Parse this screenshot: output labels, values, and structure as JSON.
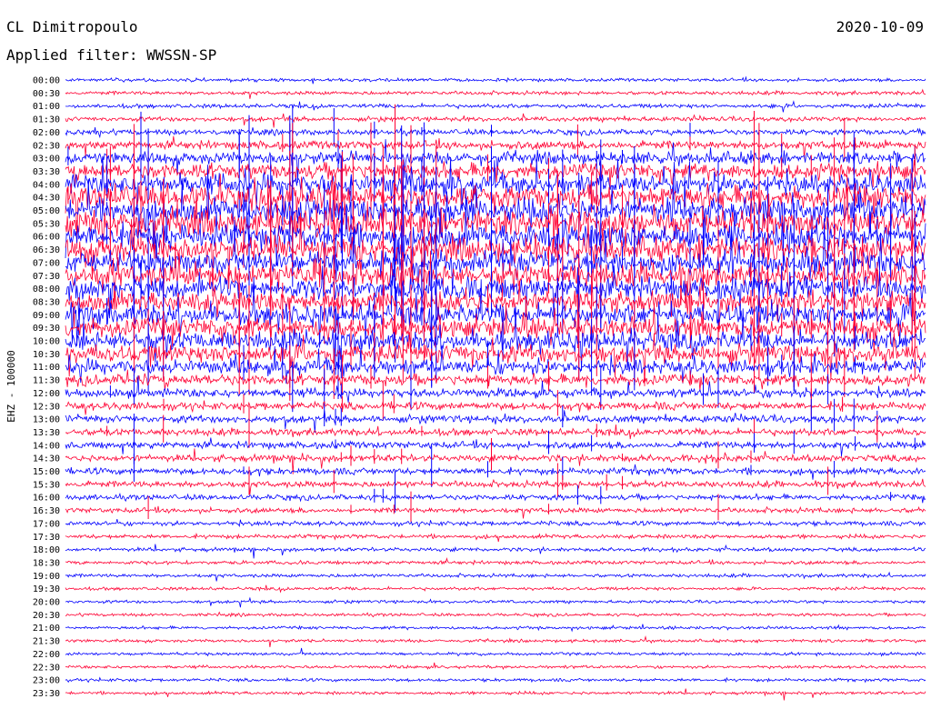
{
  "header": {
    "station": "CL Dimitropoulo",
    "filter_prefix": "Applied filter:",
    "filter_name": "WWSSN-SP",
    "date": "2020-10-09"
  },
  "chart_data": {
    "type": "line",
    "title": "CL Dimitropoulo",
    "subtitle": "Applied filter: WWSSN-SP",
    "date": "2020-10-09",
    "ylabel": "EHZ - 100000",
    "xlabel": "",
    "row_labels": [
      "00:00",
      "00:30",
      "01:00",
      "01:30",
      "02:00",
      "02:30",
      "03:00",
      "03:30",
      "04:00",
      "04:30",
      "05:00",
      "05:30",
      "06:00",
      "06:30",
      "07:00",
      "07:30",
      "08:00",
      "08:30",
      "09:00",
      "09:30",
      "10:00",
      "10:30",
      "11:00",
      "11:30",
      "12:00",
      "12:30",
      "13:00",
      "13:30",
      "14:00",
      "14:30",
      "15:00",
      "15:30",
      "16:00",
      "16:30",
      "17:00",
      "17:30",
      "18:00",
      "18:30",
      "19:00",
      "19:30",
      "20:00",
      "20:30",
      "21:00",
      "21:30",
      "22:00",
      "22:30",
      "23:00",
      "23:30"
    ],
    "row_minutes": 30,
    "series_colors": [
      "#0000ff",
      "#ff0033"
    ],
    "relative_amplitude": [
      0.35,
      0.4,
      0.45,
      0.5,
      0.6,
      0.9,
      1.3,
      1.7,
      2.1,
      2.4,
      2.6,
      2.7,
      2.6,
      2.5,
      2.4,
      2.3,
      2.3,
      2.2,
      2.2,
      2.1,
      2.0,
      1.9,
      1.6,
      1.2,
      0.95,
      0.85,
      0.8,
      0.75,
      0.75,
      0.75,
      0.72,
      0.68,
      0.6,
      0.55,
      0.5,
      0.45,
      0.42,
      0.4,
      0.38,
      0.35,
      0.33,
      0.33,
      0.33,
      0.33,
      0.33,
      0.33,
      0.34,
      0.34
    ],
    "grid": false,
    "legend": "none"
  }
}
